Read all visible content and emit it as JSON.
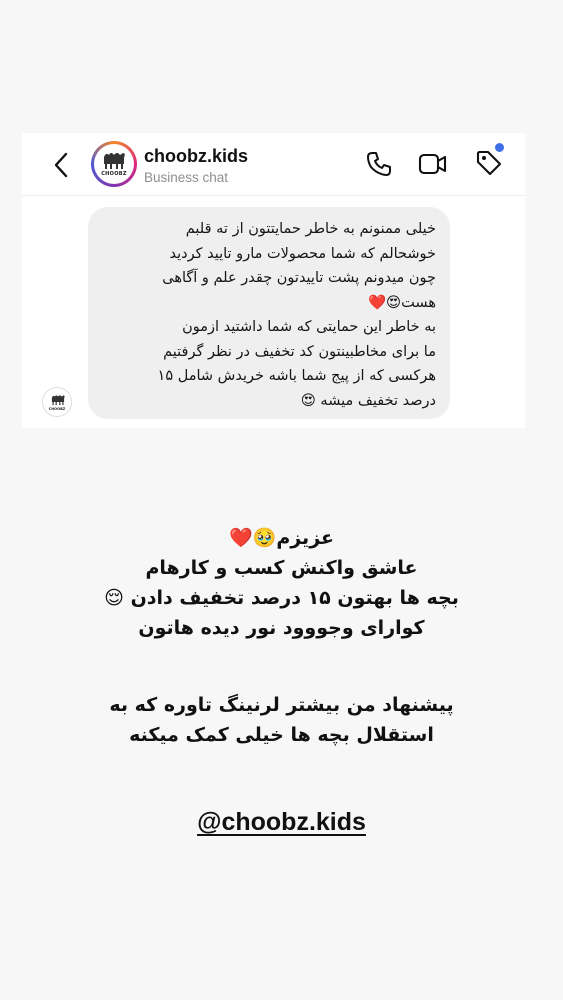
{
  "header": {
    "username": "choobz.kids",
    "subtitle": "Business chat",
    "avatar_label": "CHOOBZ"
  },
  "icons": {
    "back": "chevron-left-icon",
    "call": "phone-icon",
    "video": "video-camera-icon",
    "tag": "tag-icon"
  },
  "colors": {
    "notification_dot": "#3f6fe8",
    "bubble_background": "#efeff0",
    "ring_gradient": [
      "#f58529",
      "#dd2a7b",
      "#8134af",
      "#515bd4"
    ]
  },
  "message": {
    "lines": [
      "خیلی ممنونم به خاطر حمایتتون از ته قلبم",
      "خوشحالم که شما  محصولات مارو تایید کردید",
      "چون میدونم پشت تاییدتون چقدر علم و  آگاهی",
      "هست😍❤️",
      "به خاطر این حمایتی که شما داشتید ازمون",
      "ما برای مخاطبینتون کد تخفیف در نظر گرفتیم",
      "هرکسی که از پیج شما باشه خریدش شامل ۱۵",
      "درصد تخفیف میشه 😍"
    ]
  },
  "caption": {
    "lines": [
      "عزیزم🥹❤️",
      "عاشق واکنش کسب و کارهام",
      "بچه ها بهتون ۱۵ درصد تخفیف دادن 😌",
      "کوارای وجووود نور دیده هاتون"
    ],
    "lines2": [
      "پیشنهاد من بیشتر لرنینگ تاوره که به",
      "استقلال بچه ها خیلی کمک میکنه"
    ]
  },
  "mention": "@choobz.kids"
}
